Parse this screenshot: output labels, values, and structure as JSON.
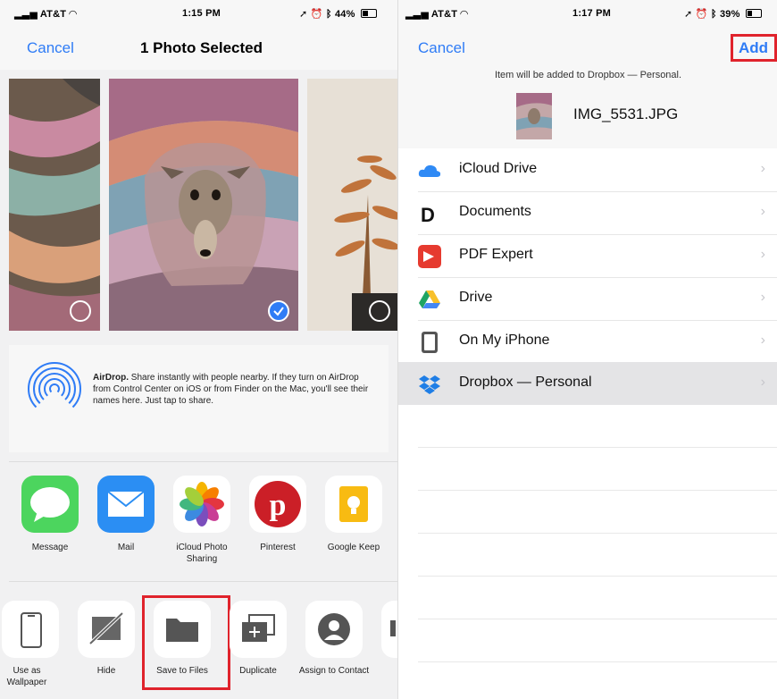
{
  "left": {
    "status": {
      "carrier": "AT&T",
      "time": "1:15 PM",
      "battery": "44%"
    },
    "nav": {
      "cancel": "Cancel",
      "title": "1 Photo Selected"
    },
    "airdrop": {
      "title": "AirDrop.",
      "text": " Share instantly with people nearby. If they turn on AirDrop from Control Center on iOS or from Finder on the Mac, you'll see their names here. Just tap to share."
    },
    "apps": [
      {
        "label": "Message"
      },
      {
        "label": "Mail"
      },
      {
        "label": "iCloud Photo Sharing"
      },
      {
        "label": "Pinterest"
      },
      {
        "label": "Google Keep"
      }
    ],
    "actions": [
      {
        "label": "Use as Wallpaper"
      },
      {
        "label": "Hide"
      },
      {
        "label": "Save to Files"
      },
      {
        "label": "Duplicate"
      },
      {
        "label": "Assign to Contact"
      }
    ]
  },
  "right": {
    "status": {
      "carrier": "AT&T",
      "time": "1:17 PM",
      "battery": "39%"
    },
    "nav": {
      "cancel": "Cancel",
      "add": "Add"
    },
    "notice": "Item will be added to Dropbox — Personal.",
    "filename": "IMG_5531.JPG",
    "locations": [
      {
        "label": "iCloud Drive",
        "icon": "icloud-icon"
      },
      {
        "label": "Documents",
        "icon": "documents-icon"
      },
      {
        "label": "PDF Expert",
        "icon": "pdf-expert-icon"
      },
      {
        "label": "Drive",
        "icon": "google-drive-icon"
      },
      {
        "label": "On My iPhone",
        "icon": "iphone-icon"
      },
      {
        "label": "Dropbox — Personal",
        "icon": "dropbox-icon",
        "selected": true
      }
    ]
  },
  "colors": {
    "link": "#2f7cf6",
    "highlight": "#e0232c"
  }
}
